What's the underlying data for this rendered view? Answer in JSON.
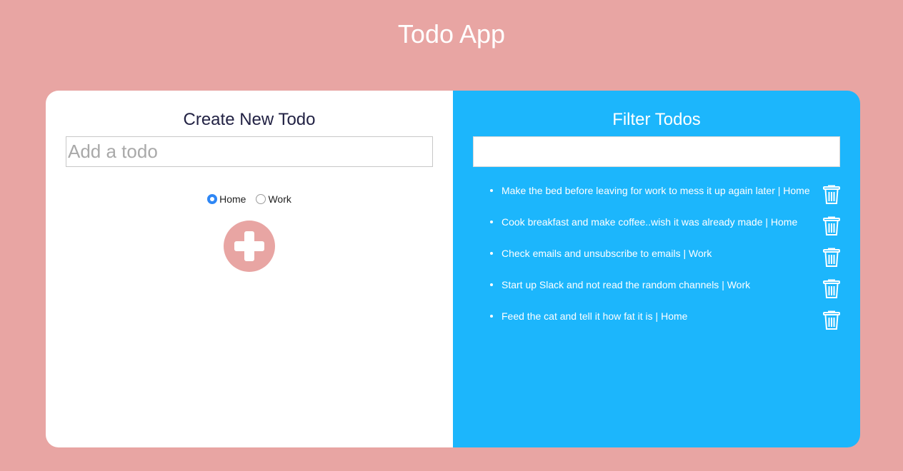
{
  "app": {
    "title": "Todo App"
  },
  "create_panel": {
    "title": "Create New Todo",
    "input_placeholder": "Add a todo",
    "input_value": "",
    "radio_options": [
      {
        "label": "Home",
        "checked": true
      },
      {
        "label": "Work",
        "checked": false
      }
    ],
    "add_button_icon": "plus-icon"
  },
  "filter_panel": {
    "title": "Filter Todos",
    "filter_value": "",
    "todos": [
      {
        "text": "Make the bed before leaving for work to mess it up again later | Home"
      },
      {
        "text": "Cook breakfast and make coffee..wish it was already made | Home"
      },
      {
        "text": "Check emails and unsubscribe to emails | Work"
      },
      {
        "text": "Start up Slack and not read the random channels | Work"
      },
      {
        "text": "Feed the cat and tell it how fat it is | Home"
      }
    ],
    "delete_icon": "trash-icon"
  },
  "colors": {
    "background": "#e8a5a3",
    "create_panel": "#ffffff",
    "filter_panel": "#1cb6fc",
    "radio_accent": "#2f87f5",
    "add_button": "#e8a5a3"
  }
}
